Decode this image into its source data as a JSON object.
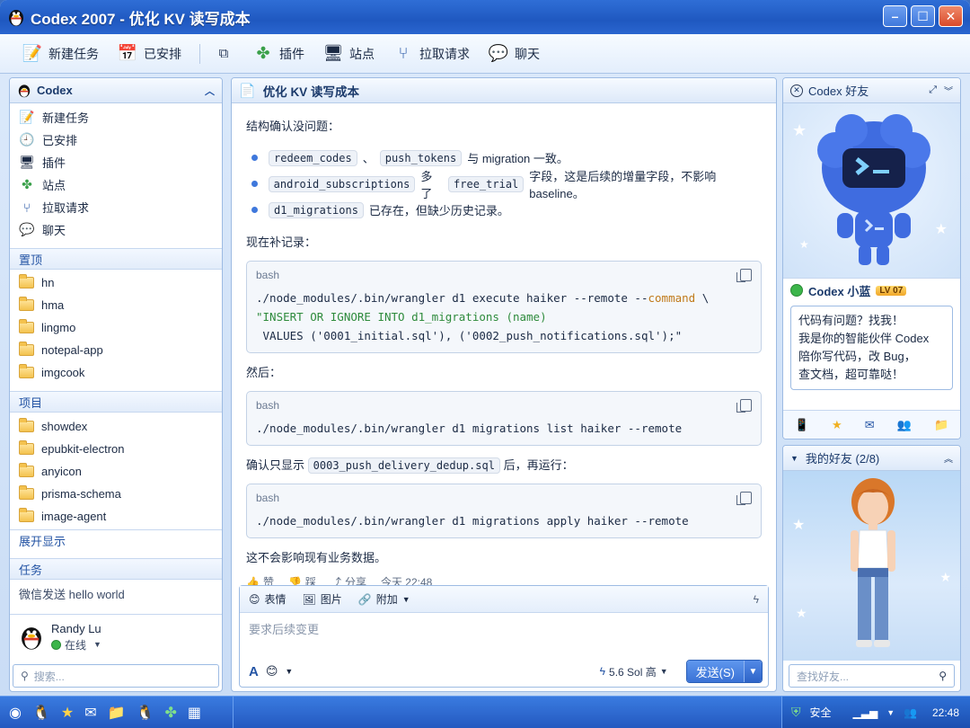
{
  "window": {
    "title": "Codex 2007 - 优化 KV 读写成本"
  },
  "toolbar": {
    "new_task": "新建任务",
    "scheduled": "已安排",
    "plugins": "插件",
    "sites": "站点",
    "pull_requests": "拉取请求",
    "chat": "聊天"
  },
  "sidebar": {
    "header": "Codex",
    "nav": [
      "新建任务",
      "已安排",
      "插件",
      "站点",
      "拉取请求",
      "聊天"
    ],
    "pinned_header": "置顶",
    "pinned": [
      "hn",
      "hma",
      "lingmo",
      "notepal-app",
      "imgcook"
    ],
    "projects_header": "项目",
    "projects": [
      "showdex",
      "epubkit-electron",
      "anyicon",
      "prisma-schema",
      "image-agent"
    ],
    "expand": "展开显示",
    "tasks_header": "任务",
    "task_item": "微信发送 hello world",
    "user_name": "Randy Lu",
    "user_status": "在线",
    "search_placeholder": "搜索..."
  },
  "chat": {
    "title": "优化 KV 读写成本",
    "intro": "结构确认没问题：",
    "b1_code1": "redeem_codes",
    "b1_sep": "、",
    "b1_code2": "push_tokens",
    "b1_text": "与 migration 一致。",
    "b2_code1": "android_subscriptions",
    "b2_mid": "多了",
    "b2_code2": "free_trial",
    "b2_text": "字段，这是后续的增量字段，不影响 baseline。",
    "b3_code1": "d1_migrations",
    "b3_text": "已存在，但缺少历史记录。",
    "now_record": "现在补记录：",
    "code1_lang": "bash",
    "code1_l1a": "./node_modules/.bin/wrangler d1 execute haiker --remote --",
    "code1_l1kw": "command",
    "code1_l1b": " \\",
    "code1_l2": "\"INSERT OR IGNORE INTO d1_migrations (name)",
    "code1_l3": " VALUES ('0001_initial.sql'), ('0002_push_notifications.sql');\"",
    "then": "然后：",
    "code2_lang": "bash",
    "code2_l1": "./node_modules/.bin/wrangler d1 migrations list haiker --remote",
    "confirm_a": "确认只显示",
    "confirm_code": "0003_push_delivery_dedup.sql",
    "confirm_b": "后，再运行：",
    "code3_lang": "bash",
    "code3_l1": "./node_modules/.bin/wrangler d1 migrations apply haiker --remote",
    "closing": "这不会影响现有业务数据。",
    "like": "赞",
    "dislike": "踩",
    "share": "分享",
    "time": "今天 22:48"
  },
  "compose": {
    "emoji": "表情",
    "image": "图片",
    "attach": "附加",
    "placeholder": "要求后续变更",
    "model": "5.6 Sol 高",
    "send": "发送(S)"
  },
  "right": {
    "header": "Codex 好友",
    "name": "Codex 小蓝",
    "level": "LV 07",
    "bubble_l1": "代码有问题？找我！",
    "bubble_l2": "我是你的智能伙伴 Codex",
    "bubble_l3": "陪你写代码，改 Bug，",
    "bubble_l4": "查文档，超可靠哒！",
    "friends_header": "我的好友 (2/8)",
    "search_placeholder": "查找好友..."
  },
  "taskbar": {
    "security": "安全",
    "clock": "22:48"
  },
  "colors": {
    "accent": "#2f6ed6",
    "link": "#2454a4",
    "online": "#3cb54a"
  }
}
